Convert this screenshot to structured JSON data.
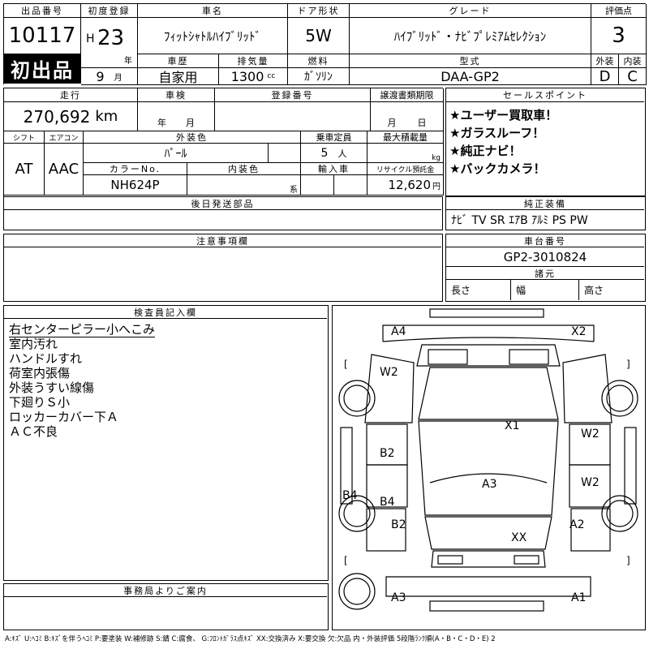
{
  "lot": {
    "label": "出品番号",
    "value": "10117",
    "badge": "初出品"
  },
  "first_reg": {
    "label": "初度登録",
    "era": "H",
    "year": "23",
    "year_unit": "年",
    "month": "9",
    "month_unit": "月"
  },
  "car_name": {
    "label": "車名",
    "value": "ﾌｨｯﾄｼｬﾄﾙﾊｲﾌﾞﾘｯﾄﾞ"
  },
  "door": {
    "label": "ドア形状",
    "value": "5W"
  },
  "grade": {
    "label": "グレード",
    "value": "ﾊｲﾌﾞﾘｯﾄﾞ・ﾅﾋﾞﾌﾟﾚﾐｱﾑｾﾚｸｼｮﾝ"
  },
  "score": {
    "label": "評価点",
    "value": "3"
  },
  "history": {
    "label": "車歴",
    "value": "自家用"
  },
  "displacement": {
    "label": "排気量",
    "value": "1300",
    "unit": "cc"
  },
  "fuel": {
    "label": "燃料",
    "value": "ｶﾞｿﾘﾝ"
  },
  "model_code": {
    "label": "型式",
    "value": "DAA-GP2"
  },
  "exterior_grade": {
    "label": "外装",
    "value": "D"
  },
  "interior_grade": {
    "label": "内装",
    "value": "C"
  },
  "mileage": {
    "label": "走行",
    "value": "270,692",
    "unit": "km"
  },
  "inspection": {
    "label": "車検",
    "year_unit": "年",
    "month_unit": "月"
  },
  "reg_no": {
    "label": "登録番号"
  },
  "transfer": {
    "label": "譲渡書類期限",
    "month_unit": "月",
    "day_unit": "日"
  },
  "shift": {
    "label": "シフト",
    "value": "AT"
  },
  "aircon": {
    "label": "エアコン",
    "value": "AAC"
  },
  "ext_color": {
    "label": "外装色",
    "value": "ﾊﾟｰﾙ"
  },
  "capacity": {
    "label": "乗車定員",
    "value": "5",
    "unit": "人"
  },
  "max_load": {
    "label": "最大積載量",
    "unit": "kg"
  },
  "color_no": {
    "label": "カラーNo.",
    "value": "NH624P"
  },
  "int_color": {
    "label": "内装色",
    "unit": "系"
  },
  "import": {
    "label": "輸入車"
  },
  "recycle": {
    "label": "リサイクル預託金",
    "value": "12,620",
    "unit": "円"
  },
  "sales_points": {
    "label": "セールスポイント",
    "items": [
      "★ユーザー買取車！",
      "★ガラスルーフ！",
      "★純正ナビ！",
      "★バックカメラ！"
    ]
  },
  "later_parts": {
    "label": "後日発送部品"
  },
  "equipment": {
    "label": "純正装備",
    "value": "ﾅﾋﾞ TV SR ｴｱB ｱﾙﾐ PS PW"
  },
  "notes": {
    "label": "注意事項欄"
  },
  "chassis": {
    "label": "車台番号",
    "value": "GP2-3010824"
  },
  "dims": {
    "label": "諸元",
    "length": "長さ",
    "width": "幅",
    "height": "高さ"
  },
  "inspector": {
    "label": "検査員記入欄",
    "lines": [
      "右センターピラー小へこみ",
      "室内汚れ",
      "ハンドルすれ",
      "荷室内張傷",
      "外装うすい線傷",
      "下廻りＳ小",
      "ロッカーカバー下Ａ",
      "ＡＣ不良"
    ]
  },
  "office": {
    "label": "事務局よりご案内"
  },
  "damage": {
    "a4": "A4",
    "x2": "X2",
    "w2_left": "W2",
    "x1": "X1",
    "w2_right_top": "W2",
    "b2_left_top": "B2",
    "a3_center": "A3",
    "w2_right_mid": "W2",
    "b4_side": "B4",
    "b4_inner": "B4",
    "b2_left_bottom": "B2",
    "a2": "A2",
    "xx": "XX",
    "a3_bottom": "A3",
    "a1": "A1"
  },
  "legend": "A:ｷｽﾞ U:ﾍｺﾐ B:ｷｽﾞを伴うﾍｺﾐ P:要塗装 W:補修跡 S:錆 C:腐食、 G:ﾌﾛﾝﾄｶﾞﾗｽ点ｷｽﾞ XX:交換済み X:要交換 欠:欠品 内・外装評価 5段階ﾗﾝｸ順(A・B・C・D・E) 2"
}
